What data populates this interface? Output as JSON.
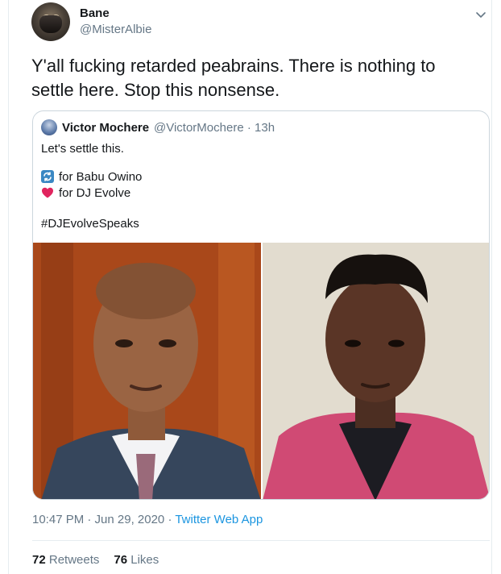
{
  "author": {
    "name": "Bane",
    "handle": "@MisterAlbie"
  },
  "tweet_text": "Y'all fucking retarded peabrains. There is nothing to settle here. Stop this nonsense.",
  "quoted": {
    "name": "Victor Mochere",
    "handle": "@VictorMochere",
    "separator": "·",
    "time": "13h",
    "line1": "Let's settle this.",
    "option1_icon": "retweet-icon",
    "option1": "for Babu Owino",
    "option2_icon": "heart-icon",
    "option2": "for DJ Evolve",
    "hashtag": "#DJEvolveSpeaks"
  },
  "timestamp": "10:47 PM · Jun 29, 2020 · ",
  "source": "Twitter Web App",
  "stats": {
    "retweets_count": "72",
    "retweets_label": "Retweets",
    "likes_count": "76",
    "likes_label": "Likes"
  },
  "colors": {
    "accent": "#1b95e0",
    "secondary_text": "#657786",
    "border": "#ccd6dd",
    "heart": "#e0245e"
  }
}
